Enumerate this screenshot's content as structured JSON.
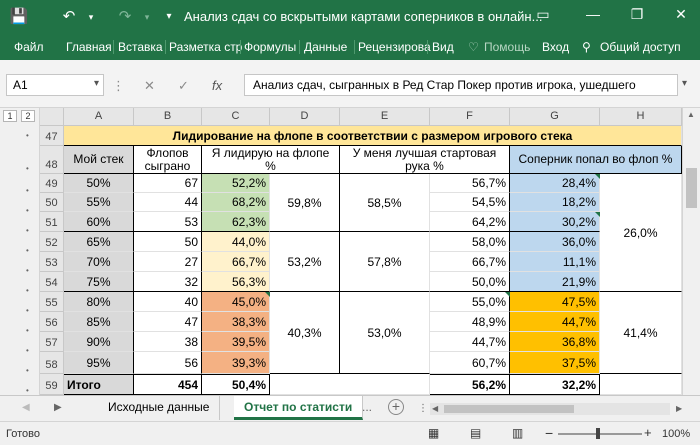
{
  "titlebar": {
    "title": "Анализ сдач со вскрытыми картами соперников в онлайн...",
    "qa_save_icon": "save-icon",
    "qa_undo_icon": "undo-icon",
    "qa_redo_icon": "redo-icon"
  },
  "ribbon": {
    "tabs": [
      "Файл",
      "Главная",
      "Вставка",
      "Разметка стр",
      "Формулы",
      "Данные",
      "Рецензирова",
      "Вид"
    ],
    "help": "Помощь",
    "login": "Вход",
    "share": "Общий доступ"
  },
  "formula_bar": {
    "name_box": "A1",
    "cancel_glyph": "✕",
    "enter_glyph": "✓",
    "fx": "fx",
    "formula": "Анализ сдач, сыгранных в Ред Стар Покер против игрока, ушедшего"
  },
  "outline": {
    "levels": [
      "1",
      "2"
    ]
  },
  "columns": [
    "A",
    "B",
    "C",
    "D",
    "E",
    "F",
    "G",
    "H"
  ],
  "rows": [
    "47",
    "48",
    "49",
    "50",
    "51",
    "52",
    "53",
    "54",
    "55",
    "56",
    "57",
    "58",
    "59"
  ],
  "table": {
    "title": "Лидирование на флопе в соответствии с размером игрового стека",
    "headers": {
      "a": "Мой стек",
      "b": "Флопов сыграно",
      "c": "Я лидирую на флопе %",
      "e": "У меня лучшая стартовая рука %",
      "g": "Соперник попал во флоп %"
    },
    "data": [
      {
        "a": "50%",
        "b": "67",
        "c": "52,2%",
        "f": "56,7%",
        "g": "28,4%"
      },
      {
        "a": "55%",
        "b": "44",
        "c": "68,2%",
        "f": "54,5%",
        "g": "18,2%"
      },
      {
        "a": "60%",
        "b": "53",
        "c": "62,3%",
        "f": "64,2%",
        "g": "30,2%"
      },
      {
        "a": "65%",
        "b": "50",
        "c": "44,0%",
        "f": "58,0%",
        "g": "36,0%"
      },
      {
        "a": "70%",
        "b": "27",
        "c": "66,7%",
        "f": "66,7%",
        "g": "11,1%"
      },
      {
        "a": "75%",
        "b": "32",
        "c": "56,3%",
        "f": "50,0%",
        "g": "21,9%"
      },
      {
        "a": "80%",
        "b": "40",
        "c": "45,0%",
        "f": "55,0%",
        "g": "47,5%"
      },
      {
        "a": "85%",
        "b": "47",
        "c": "38,3%",
        "f": "48,9%",
        "g": "44,7%"
      },
      {
        "a": "90%",
        "b": "38",
        "c": "39,5%",
        "f": "44,7%",
        "g": "36,8%"
      },
      {
        "a": "95%",
        "b": "56",
        "c": "39,3%",
        "f": "60,7%",
        "g": "37,5%"
      }
    ],
    "groups_d": [
      "59,8%",
      "53,2%",
      "40,3%"
    ],
    "groups_e": [
      "58,5%",
      "57,8%",
      "53,0%"
    ],
    "groups_h": [
      "26,0%",
      "41,4%"
    ],
    "total": {
      "a": "Итого",
      "b": "454",
      "c": "50,4%",
      "f": "56,2%",
      "g": "32,2%"
    }
  },
  "sheets": {
    "tabs": [
      "Исходные данные",
      "Отчет по статисти"
    ],
    "more": "...",
    "add": "+"
  },
  "status": {
    "ready": "Готово",
    "zoom": "100%"
  },
  "colors": {
    "accent": "#217346",
    "title_fill": "#ffe699",
    "green": "#c6e0b4",
    "yellow": "#fff2cc",
    "salmon": "#f4b183",
    "blue": "#bdd7ee",
    "orange": "#ffc000",
    "gray": "#d9d9d9"
  }
}
